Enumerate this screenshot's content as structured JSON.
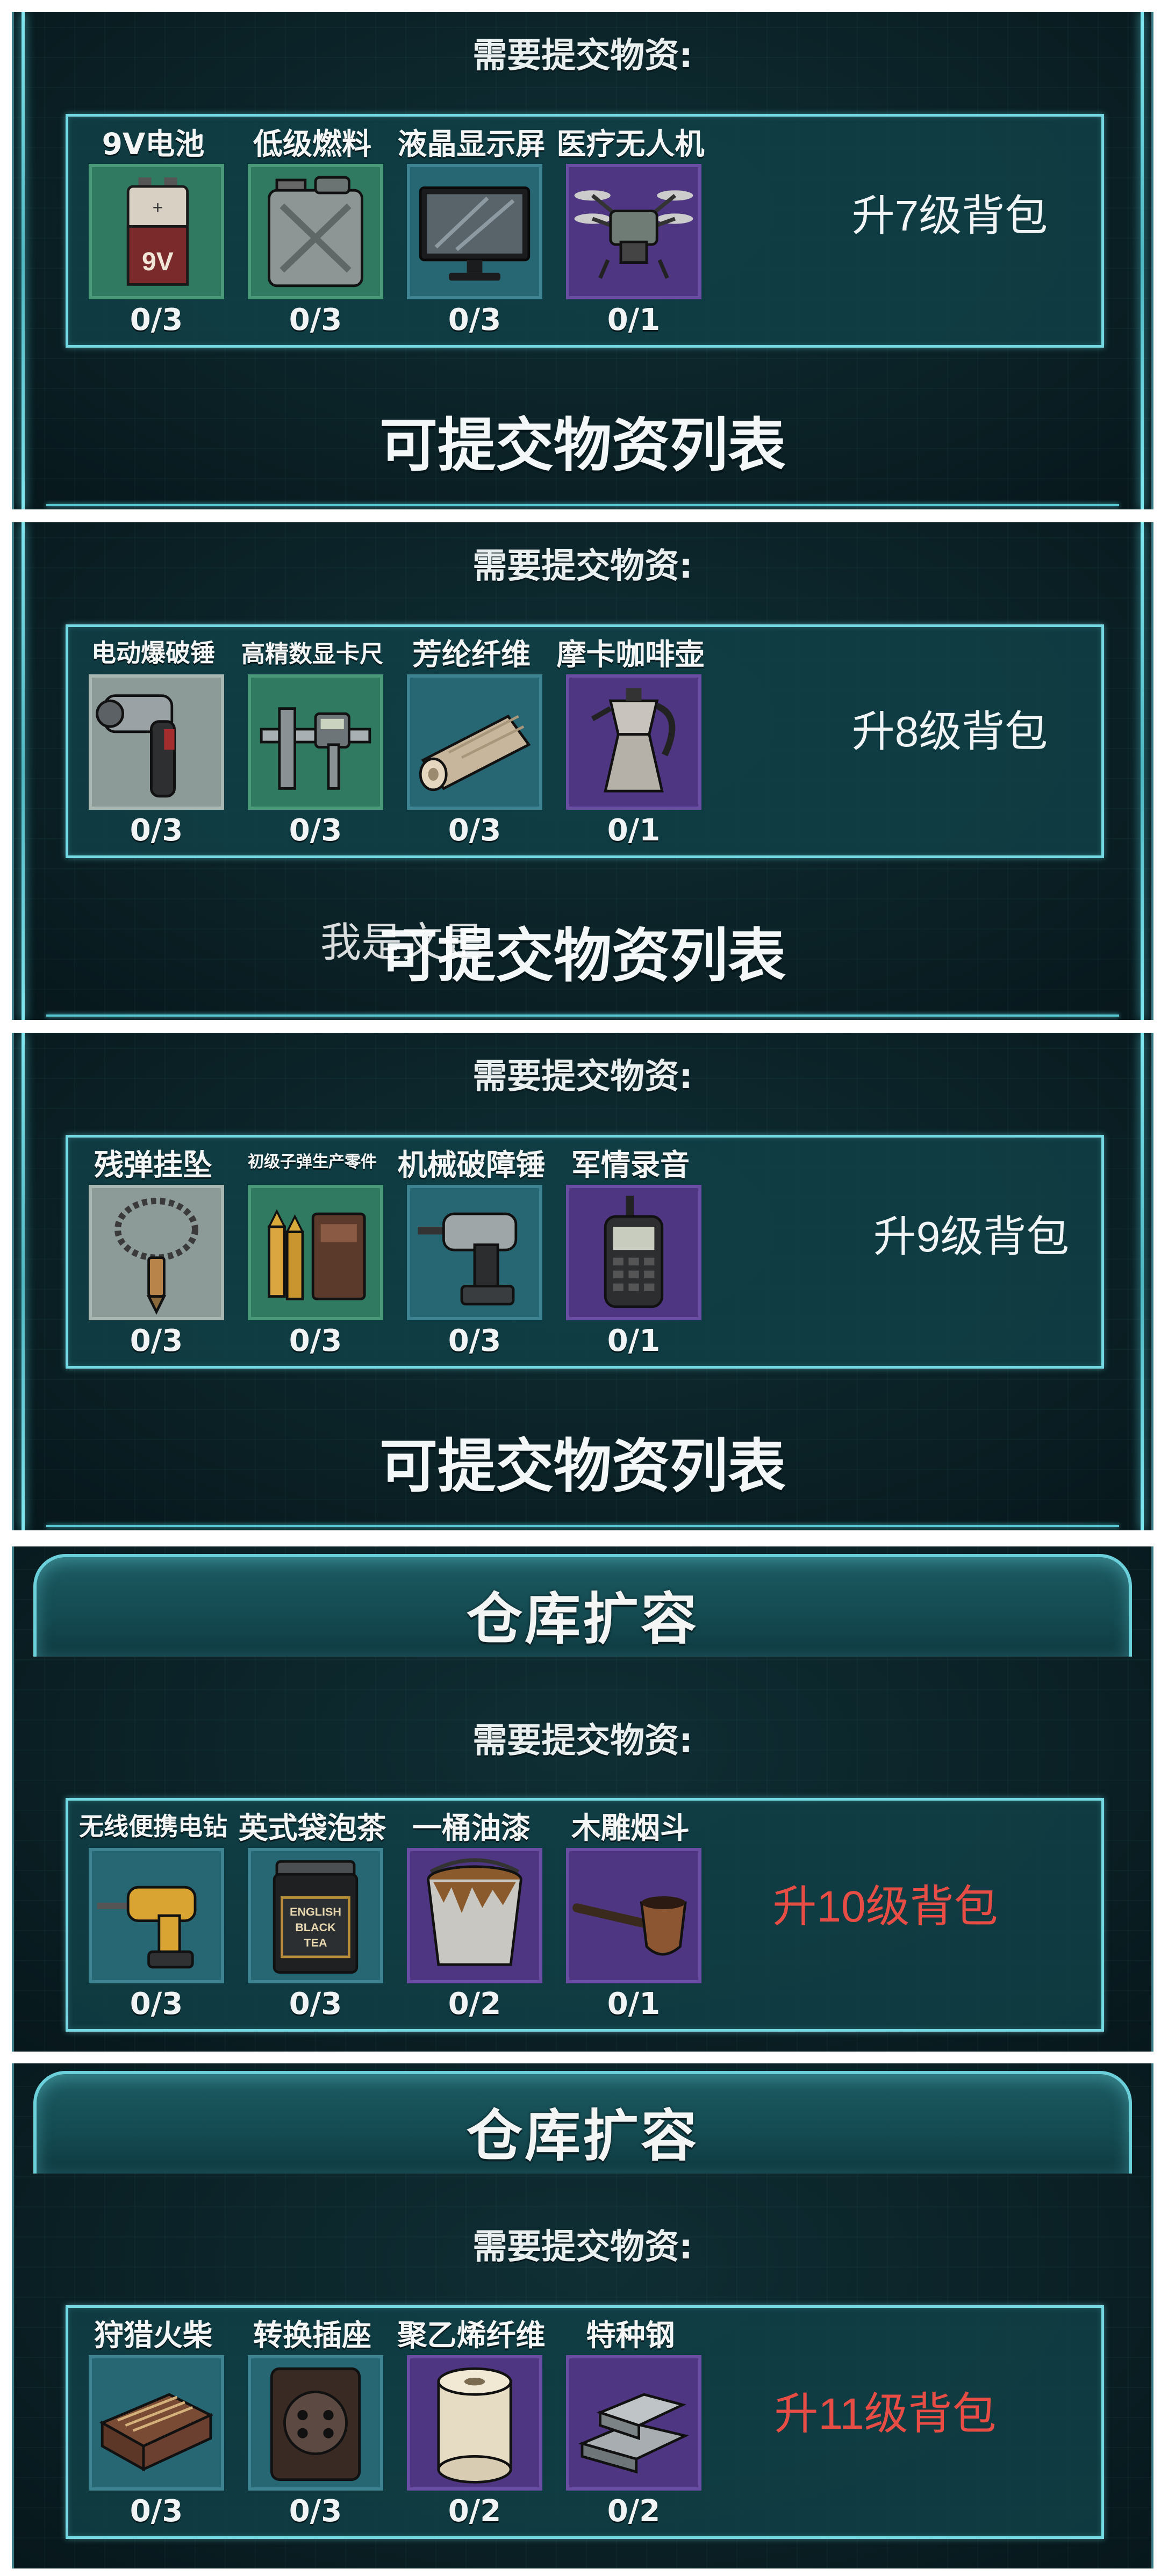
{
  "sections": [
    {
      "need_label": "需要提交物资:",
      "items": [
        {
          "name": "9V电池",
          "count": "0/3",
          "icon": "battery-9v-icon",
          "slot": "green"
        },
        {
          "name": "低级燃料",
          "count": "0/3",
          "icon": "fuel-can-icon",
          "slot": "green"
        },
        {
          "name": "液晶显示屏",
          "count": "0/3",
          "icon": "lcd-monitor-icon",
          "slot": "blue"
        },
        {
          "name": "医疗无人机",
          "count": "0/1",
          "icon": "medical-drone-icon",
          "slot": "purple"
        }
      ],
      "upgrade": "升7级背包",
      "list_title": "可提交物资列表"
    },
    {
      "need_label": "需要提交物资:",
      "items": [
        {
          "name": "电动爆破锤",
          "count": "0/3",
          "icon": "demolition-hammer-icon",
          "slot": "grey"
        },
        {
          "name": "高精数显卡尺",
          "count": "0/3",
          "icon": "digital-caliper-icon",
          "slot": "green"
        },
        {
          "name": "芳纶纤维",
          "count": "0/3",
          "icon": "aramid-fiber-roll-icon",
          "slot": "blue"
        },
        {
          "name": "摩卡咖啡壶",
          "count": "0/1",
          "icon": "moka-pot-icon",
          "slot": "purple"
        }
      ],
      "upgrade": "升8级背包",
      "list_title": "可提交物资列表",
      "watermark": "我是文是"
    },
    {
      "need_label": "需要提交物资:",
      "items": [
        {
          "name": "残弹挂坠",
          "count": "0/3",
          "icon": "bullet-pendant-icon",
          "slot": "grey"
        },
        {
          "name": "初级子弹生产零件",
          "count": "0/3",
          "icon": "bullet-parts-icon",
          "slot": "green"
        },
        {
          "name": "机械破障锤",
          "count": "0/3",
          "icon": "power-drill-icon",
          "slot": "blue"
        },
        {
          "name": "军情录音",
          "count": "0/1",
          "icon": "radio-recorder-icon",
          "slot": "purple"
        }
      ],
      "upgrade": "升9级背包",
      "list_title": "可提交物资列表"
    },
    {
      "header": "仓库扩容",
      "need_label": "需要提交物资:",
      "items": [
        {
          "name": "无线便携电钻",
          "count": "0/3",
          "icon": "cordless-drill-icon",
          "slot": "blue"
        },
        {
          "name": "英式袋泡茶",
          "count": "0/3",
          "icon": "tea-tin-icon",
          "slot": "blue",
          "icon_text": [
            "ENGLISH",
            "BLACK",
            "TEA"
          ]
        },
        {
          "name": "一桶油漆",
          "count": "0/2",
          "icon": "paint-bucket-icon",
          "slot": "purple"
        },
        {
          "name": "木雕烟斗",
          "count": "0/1",
          "icon": "wooden-pipe-icon",
          "slot": "purple"
        }
      ],
      "upgrade": "升10级背包",
      "upgrade_color": "#e84d45"
    },
    {
      "header": "仓库扩容",
      "need_label": "需要提交物资:",
      "items": [
        {
          "name": "狩猎火柴",
          "count": "0/3",
          "icon": "matchbox-icon",
          "slot": "blue"
        },
        {
          "name": "转换插座",
          "count": "0/3",
          "icon": "power-socket-icon",
          "slot": "blue"
        },
        {
          "name": "聚乙烯纤维",
          "count": "0/2",
          "icon": "fiber-spool-icon",
          "slot": "purple"
        },
        {
          "name": "特种钢",
          "count": "0/2",
          "icon": "steel-ingot-icon",
          "slot": "purple"
        }
      ],
      "upgrade": "升11级背包",
      "upgrade_color": "#e84d45"
    }
  ]
}
